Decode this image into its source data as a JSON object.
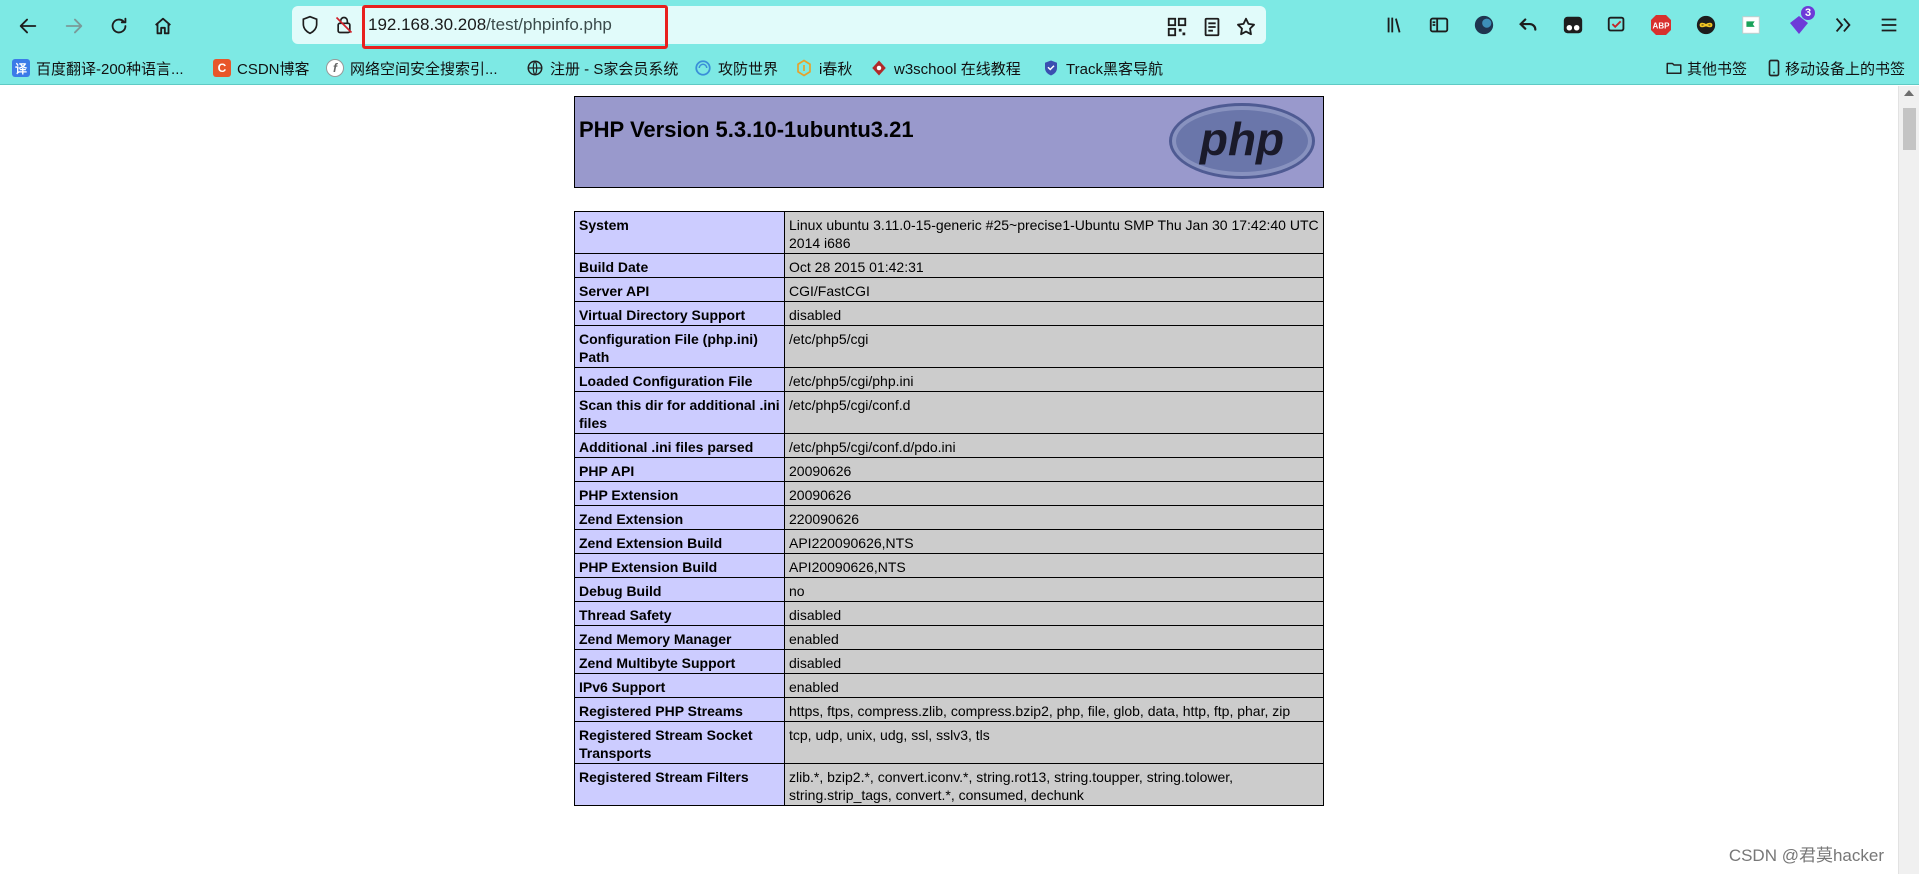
{
  "browser": {
    "url_host": "192.168.30.208",
    "url_path": "/test/phpinfo.php"
  },
  "bookmarks": [
    {
      "label": "百度翻译-200种语言...",
      "icon": "translate-icon",
      "color": "#3b7be8",
      "glyph": "译"
    },
    {
      "label": "CSDN博客",
      "icon": "csdn-icon",
      "color": "#e8562a",
      "glyph": "C"
    },
    {
      "label": "网络空间安全搜索引...",
      "icon": "fofa-icon",
      "color": "#8a8a8a",
      "glyph": "f"
    },
    {
      "label": "注册 - S家会员系统",
      "icon": "globe-icon",
      "color": "#333333",
      "glyph": ""
    },
    {
      "label": "攻防世界",
      "icon": "adworld-icon",
      "color": "#3a8fd8",
      "glyph": ""
    },
    {
      "label": "i春秋",
      "icon": "ichunqiu-icon",
      "color": "#e8a12a",
      "glyph": ""
    },
    {
      "label": "w3school 在线教程",
      "icon": "w3school-icon",
      "color": "#b02a2a",
      "glyph": ""
    },
    {
      "label": "Track黑客导航",
      "icon": "track-icon",
      "color": "#3a4fb0",
      "glyph": ""
    }
  ],
  "bookmarks_right": [
    {
      "label": "其他书签",
      "icon": "folder-icon"
    },
    {
      "label": "移动设备上的书签",
      "icon": "mobile-icon"
    }
  ],
  "toolbar_badge": "3",
  "phpinfo": {
    "title": "PHP Version 5.3.10-1ubuntu3.21",
    "logo_text": "php",
    "rows": [
      {
        "key": "System",
        "value": "Linux ubuntu 3.11.0-15-generic #25~precise1-Ubuntu SMP Thu Jan 30 17:42:40 UTC 2014 i686"
      },
      {
        "key": "Build Date",
        "value": "Oct 28 2015 01:42:31"
      },
      {
        "key": "Server API",
        "value": "CGI/FastCGI"
      },
      {
        "key": "Virtual Directory Support",
        "value": "disabled"
      },
      {
        "key": "Configuration File (php.ini) Path",
        "value": "/etc/php5/cgi"
      },
      {
        "key": "Loaded Configuration File",
        "value": "/etc/php5/cgi/php.ini"
      },
      {
        "key": "Scan this dir for additional .ini files",
        "value": "/etc/php5/cgi/conf.d"
      },
      {
        "key": "Additional .ini files parsed",
        "value": "/etc/php5/cgi/conf.d/pdo.ini"
      },
      {
        "key": "PHP API",
        "value": "20090626"
      },
      {
        "key": "PHP Extension",
        "value": "20090626"
      },
      {
        "key": "Zend Extension",
        "value": "220090626"
      },
      {
        "key": "Zend Extension Build",
        "value": "API220090626,NTS"
      },
      {
        "key": "PHP Extension Build",
        "value": "API20090626,NTS"
      },
      {
        "key": "Debug Build",
        "value": "no"
      },
      {
        "key": "Thread Safety",
        "value": "disabled"
      },
      {
        "key": "Zend Memory Manager",
        "value": "enabled"
      },
      {
        "key": "Zend Multibyte Support",
        "value": "disabled"
      },
      {
        "key": "IPv6 Support",
        "value": "enabled"
      },
      {
        "key": "Registered PHP Streams",
        "value": "https, ftps, compress.zlib, compress.bzip2, php, file, glob, data, http, ftp, phar, zip"
      },
      {
        "key": "Registered Stream Socket Transports",
        "value": "tcp, udp, unix, udg, ssl, sslv3, tls"
      },
      {
        "key": "Registered Stream Filters",
        "value": "zlib.*, bzip2.*, convert.iconv.*, string.rot13, string.toupper, string.tolower, string.strip_tags, convert.*, consumed, dechunk"
      }
    ]
  },
  "watermark": "CSDN @君莫hacker"
}
